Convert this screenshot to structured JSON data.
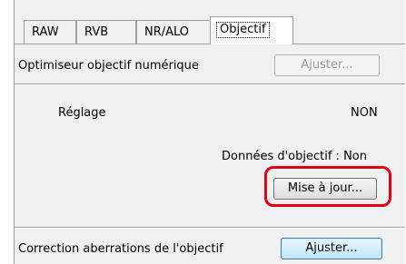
{
  "tabs": [
    {
      "label": "RAW"
    },
    {
      "label": "RVB"
    },
    {
      "label": "NR/ALO"
    },
    {
      "label": "Objectif"
    }
  ],
  "optimizer": {
    "label": "Optimiseur objectif numérique",
    "button_label": "Ajuster..."
  },
  "setting": {
    "label": "Réglage",
    "value": "NON"
  },
  "lens_data": {
    "label": "Données d'objectif : Non",
    "update_button_label": "Mise à jour..."
  },
  "aberration": {
    "label": "Correction aberrations de l'objectif",
    "button_label": "Ajuster..."
  },
  "colors": {
    "highlight": "#e60012",
    "focus_button": "#bee6fd"
  }
}
